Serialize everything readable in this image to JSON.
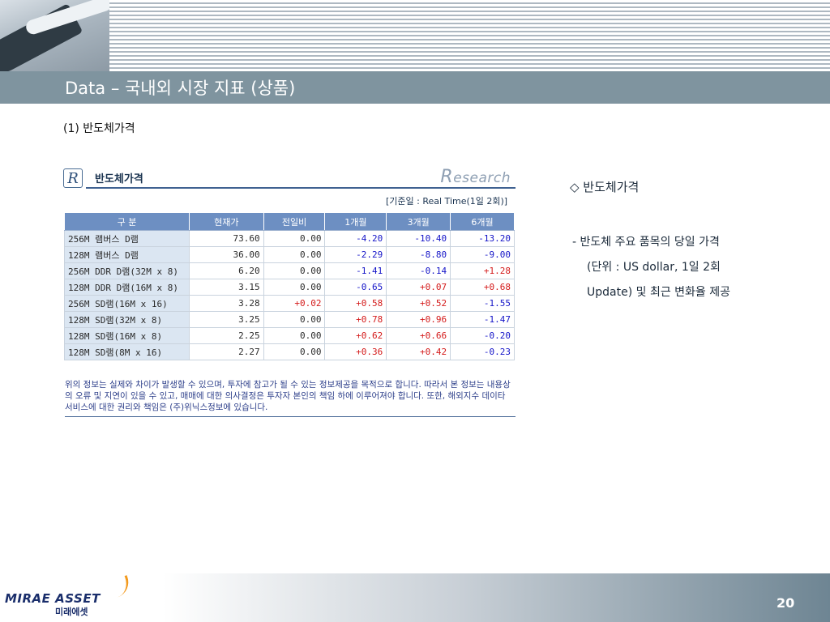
{
  "header": {
    "title": "Data – 국내외 시장 지표 (상품)"
  },
  "section_title": "(1) 반도체가격",
  "widget": {
    "logo_letter": "R",
    "title": "반도체가격",
    "brand_initial": "R",
    "brand_rest": "esearch",
    "basis": "[기준일 : Real Time(1일 2회)]",
    "columns": [
      "구 분",
      "현재가",
      "전일비",
      "1개월",
      "3개월",
      "6개월"
    ],
    "rows": [
      {
        "name": "256M 램버스 D램",
        "price": "73.60",
        "prev": "0.00",
        "m1": "-4.20",
        "m3": "-10.40",
        "m6": "-13.20"
      },
      {
        "name": "128M 램버스 D램",
        "price": "36.00",
        "prev": "0.00",
        "m1": "-2.29",
        "m3": "-8.80",
        "m6": "-9.00"
      },
      {
        "name": "256M DDR D램(32M x 8)",
        "price": "6.20",
        "prev": "0.00",
        "m1": "-1.41",
        "m3": "-0.14",
        "m6": "+1.28"
      },
      {
        "name": "128M DDR D램(16M x 8)",
        "price": "3.15",
        "prev": "0.00",
        "m1": "-0.65",
        "m3": "+0.07",
        "m6": "+0.68"
      },
      {
        "name": "256M SD램(16M x 16)",
        "price": "3.28",
        "prev": "+0.02",
        "m1": "+0.58",
        "m3": "+0.52",
        "m6": "-1.55"
      },
      {
        "name": "128M SD램(32M x 8)",
        "price": "3.25",
        "prev": "0.00",
        "m1": "+0.78",
        "m3": "+0.96",
        "m6": "-1.47"
      },
      {
        "name": "128M SD램(16M x 8)",
        "price": "2.25",
        "prev": "0.00",
        "m1": "+0.62",
        "m3": "+0.66",
        "m6": "-0.20"
      },
      {
        "name": "128M SD램(8M x 16)",
        "price": "2.27",
        "prev": "0.00",
        "m1": "+0.36",
        "m3": "+0.42",
        "m6": "-0.23"
      }
    ],
    "disclaimer": "위의 정보는 실제와 차이가 발생할 수 있으며, 투자에 참고가 될 수 있는 정보제공을 목적으로 합니다. 따라서 본 정보는 내용상의 오류 및 지연이 있을 수 있고, 매매에 대한 의사결정은 투자자 본인의 책임 하에 이루어져야 합니다. 또한, 해외지수 데이타 서비스에 대한 권리와 책임은 (주)위닉스정보에 있습니다."
  },
  "side": {
    "heading": "◇ 반도체가격",
    "line1": "- 반도체 주요 품목의 당일 가격",
    "line2": "(단위 : US dollar, 1일 2회",
    "line3": "Update) 및 최근 변화율 제공"
  },
  "footer": {
    "logo_en": "MIRAE ASSET",
    "logo_ko": "미래에셋",
    "page_number": "20"
  },
  "colors": {
    "title_bar": "#7f949f",
    "table_header": "#6d8fc2",
    "name_cell": "#dbe6f2",
    "negative": "#1414c8",
    "positive": "#d41a1a"
  }
}
